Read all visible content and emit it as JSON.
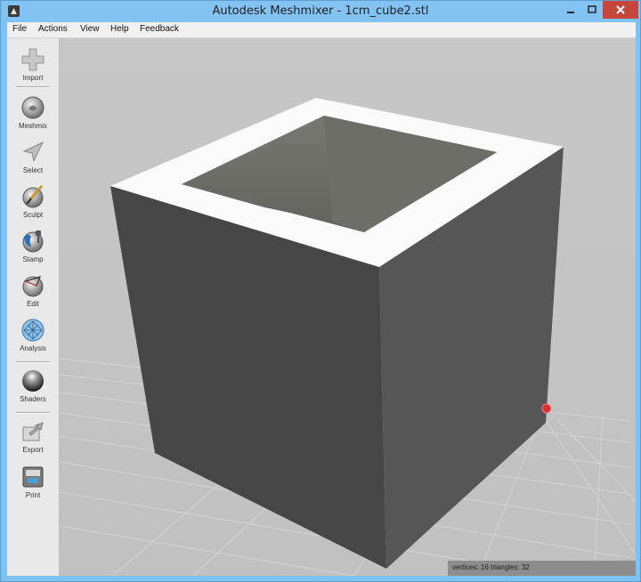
{
  "window": {
    "title": "Autodesk Meshmixer - 1cm_cube2.stl",
    "accent_color": "#82c3f3",
    "close_color": "#c7463b"
  },
  "menu": [
    "File",
    "Actions",
    "View",
    "Help",
    "Feedback"
  ],
  "toolbar": {
    "items": [
      {
        "label": "Import",
        "icon": "plus-icon"
      },
      {
        "label": "Meshmix",
        "icon": "meshmix-icon"
      },
      {
        "label": "Select",
        "icon": "select-arrow-icon"
      },
      {
        "label": "Sculpt",
        "icon": "sculpt-brush-icon"
      },
      {
        "label": "Stamp",
        "icon": "stamp-icon"
      },
      {
        "label": "Edit",
        "icon": "edit-icon"
      },
      {
        "label": "Analysis",
        "icon": "analysis-icon"
      },
      {
        "label": "Shaders",
        "icon": "shaders-icon"
      },
      {
        "label": "Export",
        "icon": "export-icon"
      },
      {
        "label": "Print",
        "icon": "printer-icon"
      }
    ]
  },
  "viewport": {
    "object": "hollow-cube-mesh",
    "status": "vertices: 16 triangles: 32"
  }
}
